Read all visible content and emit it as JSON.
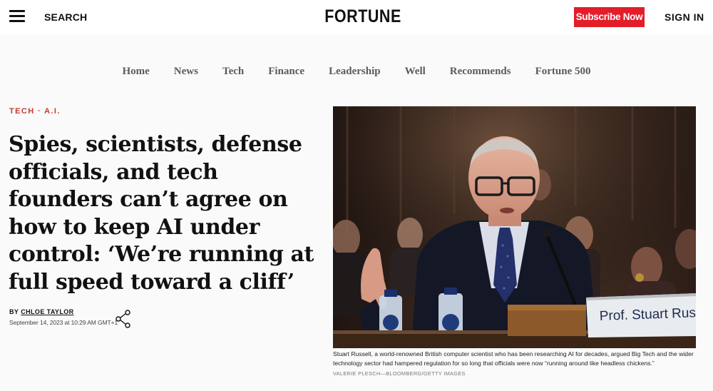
{
  "header": {
    "menu_icon": "hamburger-icon",
    "search_label": "SEARCH",
    "logo": "FORTUNE",
    "subscribe_label": "Subscribe Now",
    "signin_label": "SIGN IN",
    "subscribe_color": "#e31d2a"
  },
  "nav": {
    "items": [
      "Home",
      "News",
      "Tech",
      "Finance",
      "Leadership",
      "Well",
      "Recommends",
      "Fortune 500"
    ]
  },
  "article": {
    "kicker_section": "TECH",
    "kicker_separator": " · ",
    "kicker_topic": "A.I.",
    "kicker_color": "#c53c2d",
    "headline": "Spies, scientists, defense officials, and tech founders can’t agree on how to keep AI under control: ‘We’re running at full speed toward a cliff’",
    "by_label": "BY",
    "author": "CHLOE TAYLOR",
    "date": "September 14, 2023 at 10:29 AM GMT+1",
    "share_icon": "share-icon"
  },
  "photo": {
    "nameplate": "Prof. Stuart Russell",
    "caption": "Stuart Russell, a world-renowned British computer scientist who has been researching AI for decades, argued Big Tech and the wider technology sector had hampered regulation for so long that officials were now “running around like headless chickens.”",
    "credit": "VALERIE PLESCH—BLOOMBERG/GETTY IMAGES"
  }
}
